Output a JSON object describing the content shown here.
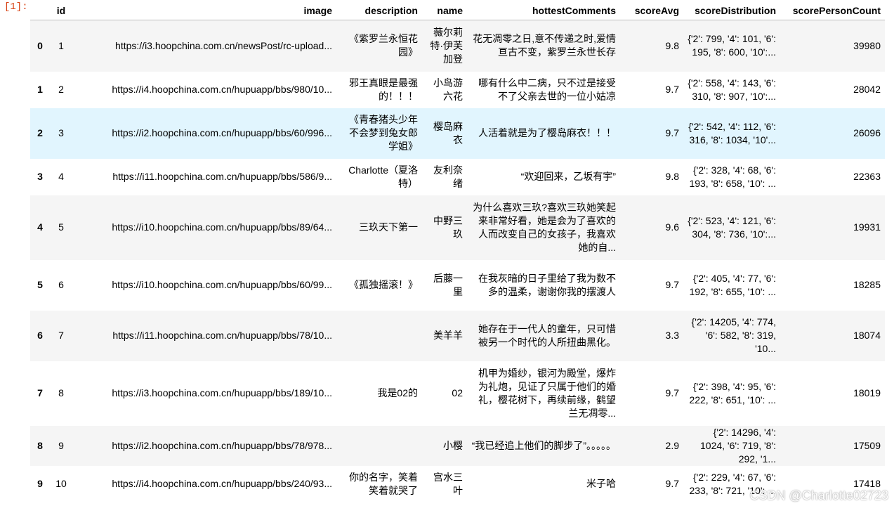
{
  "cell": {
    "prompt": "[1]:"
  },
  "table": {
    "columns": [
      "id",
      "image",
      "description",
      "name",
      "hottestComments",
      "scoreAvg",
      "scoreDistribution",
      "scorePersonCount"
    ],
    "rows": [
      {
        "index": "0",
        "id": "1",
        "image": "https://i3.hoopchina.com.cn/newsPost/rc-upload...",
        "description": "《紫罗兰永恒花园》",
        "name": "薇尔莉特·伊芙加登",
        "hottestComments": "花无凋零之日,意不传递之时,爱情亘古不变，紫罗兰永世长存",
        "scoreAvg": "9.8",
        "scoreDistribution": "{'2': 799, '4': 101, '6': 195, '8': 600, '10':...",
        "scorePersonCount": "39980"
      },
      {
        "index": "1",
        "id": "2",
        "image": "https://i4.hoopchina.com.cn/hupuapp/bbs/980/10...",
        "description": "邪王真眼是最强的！！！",
        "name": "小鸟游六花",
        "hottestComments": "哪有什么中二病，只不过是接受不了父亲去世的一位小姑凉",
        "scoreAvg": "9.7",
        "scoreDistribution": "{'2': 558, '4': 143, '6': 310, '8': 907, '10':...",
        "scorePersonCount": "28042"
      },
      {
        "index": "2",
        "id": "3",
        "image": "https://i2.hoopchina.com.cn/hupuapp/bbs/60/996...",
        "description": "《青春猪头少年不会梦到兔女郎学姐》",
        "name": "樱岛麻衣",
        "hottestComments": "人活着就是为了樱岛麻衣！！！",
        "scoreAvg": "9.7",
        "scoreDistribution": "{'2': 542, '4': 112, '6': 316, '8': 1034, '10'...",
        "scorePersonCount": "26096"
      },
      {
        "index": "3",
        "id": "4",
        "image": "https://i11.hoopchina.com.cn/hupuapp/bbs/586/9...",
        "description": "Charlotte（夏洛特）",
        "name": "友利奈绪",
        "hottestComments": "“欢迎回来，乙坂有宇”",
        "scoreAvg": "9.8",
        "scoreDistribution": "{'2': 328, '4': 68, '6': 193, '8': 658, '10': ...",
        "scorePersonCount": "22363"
      },
      {
        "index": "4",
        "id": "5",
        "image": "https://i10.hoopchina.com.cn/hupuapp/bbs/89/64...",
        "description": "三玖天下第一",
        "name": "中野三玖",
        "hottestComments": "为什么喜欢三玖?喜欢三玖她笑起来非常好看，她是会为了喜欢的人而改变自己的女孩子，我喜欢她的自...",
        "scoreAvg": "9.6",
        "scoreDistribution": "{'2': 523, '4': 121, '6': 304, '8': 736, '10':...",
        "scorePersonCount": "19931"
      },
      {
        "index": "5",
        "id": "6",
        "image": "https://i10.hoopchina.com.cn/hupuapp/bbs/60/99...",
        "description": "《孤独摇滚！》",
        "name": "后藤一里",
        "hottestComments": "在我灰暗的日子里给了我为数不多的温柔，谢谢你我的摆渡人",
        "scoreAvg": "9.7",
        "scoreDistribution": "{'2': 405, '4': 77, '6': 192, '8': 655, '10': ...",
        "scorePersonCount": "18285"
      },
      {
        "index": "6",
        "id": "7",
        "image": "https://i11.hoopchina.com.cn/hupuapp/bbs/78/10...",
        "description": "",
        "name": "美羊羊",
        "hottestComments": "她存在于一代人的童年，只可惜被另一个时代的人所扭曲黑化。",
        "scoreAvg": "3.3",
        "scoreDistribution": "{'2': 14205, '4': 774, '6': 582, '8': 319, '10...",
        "scorePersonCount": "18074"
      },
      {
        "index": "7",
        "id": "8",
        "image": "https://i3.hoopchina.com.cn/hupuapp/bbs/189/10...",
        "description": "我是02的",
        "name": "02",
        "hottestComments": "机甲为婚纱，银河为殿堂，爆炸为礼炮，见证了只属于他们的婚礼，樱花树下，再续前缘，鹤望兰无凋零...",
        "scoreAvg": "9.7",
        "scoreDistribution": "{'2': 398, '4': 95, '6': 222, '8': 651, '10': ...",
        "scorePersonCount": "18019"
      },
      {
        "index": "8",
        "id": "9",
        "image": "https://i2.hoopchina.com.cn/hupuapp/bbs/78/978...",
        "description": "",
        "name": "小樱",
        "hottestComments": "“我已经追上他们的脚步了”。。。。。",
        "scoreAvg": "2.9",
        "scoreDistribution": "{'2': 14296, '4': 1024, '6': 719, '8': 292, '1...",
        "scorePersonCount": "17509"
      },
      {
        "index": "9",
        "id": "10",
        "image": "https://i4.hoopchina.com.cn/hupuapp/bbs/240/93...",
        "description": "你的名字，笑着笑着就哭了",
        "name": "宫水三叶",
        "hottestComments": "米子哈",
        "scoreAvg": "9.7",
        "scoreDistribution": "{'2': 229, '4': 67, '6': 233, '8': 721, '10': ...",
        "scorePersonCount": "17418"
      }
    ]
  },
  "watermark": "CSDN @Charlotte02723"
}
